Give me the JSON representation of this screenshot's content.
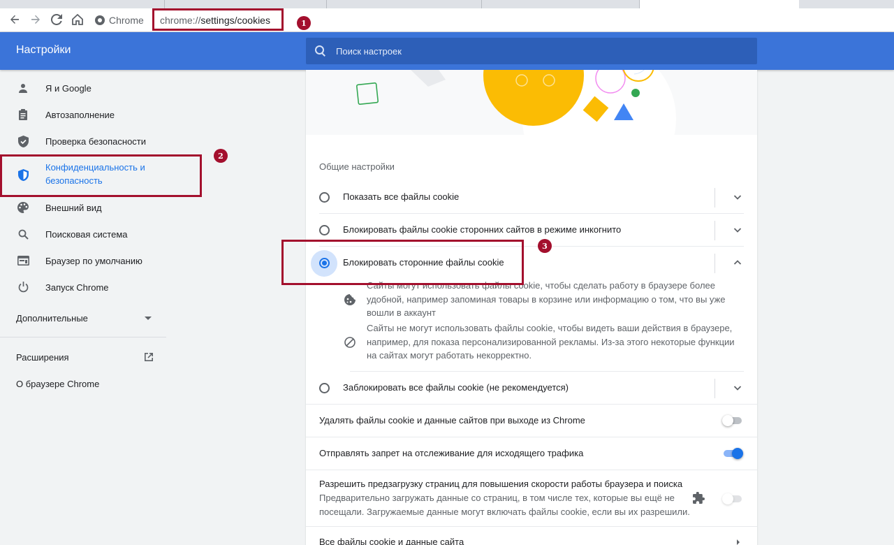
{
  "toolbar": {
    "chip_label": "Chrome",
    "url_prefix": "chrome://",
    "url_path": "settings/cookies"
  },
  "callouts": [
    "1",
    "2",
    "3"
  ],
  "header": {
    "title": "Настройки",
    "search_placeholder": "Поиск настроек"
  },
  "sidebar": {
    "items": [
      {
        "label": "Я и Google",
        "icon": "person-icon"
      },
      {
        "label": "Автозаполнение",
        "icon": "clipboard-icon"
      },
      {
        "label": "Проверка безопасности",
        "icon": "shield-check-icon"
      },
      {
        "label": "Конфиденциальность и безопасность",
        "icon": "shield-icon",
        "active": true
      },
      {
        "label": "Внешний вид",
        "icon": "palette-icon"
      },
      {
        "label": "Поисковая система",
        "icon": "search-icon"
      },
      {
        "label": "Браузер по умолчанию",
        "icon": "browser-icon"
      },
      {
        "label": "Запуск Chrome",
        "icon": "power-icon"
      }
    ],
    "advanced_label": "Дополнительные",
    "extensions_label": "Расширения",
    "about_label": "О браузере Chrome"
  },
  "main": {
    "section_label": "Общие настройки",
    "options": [
      {
        "label": "Показать все файлы cookie",
        "checked": false,
        "expanded": false
      },
      {
        "label": "Блокировать файлы cookie сторонних сайтов в режиме инкогнито",
        "checked": false,
        "expanded": false
      },
      {
        "label": "Блокировать сторонние файлы cookie",
        "checked": true,
        "expanded": true
      },
      {
        "label": "Заблокировать все файлы cookie (не рекомендуется)",
        "checked": false,
        "expanded": false
      }
    ],
    "expanded_details": [
      {
        "icon": "cookie-icon",
        "text": "Сайты могут использовать файлы cookie, чтобы сделать работу в браузере более удобной, например запоминая товары в корзине или информацию о том, что вы уже вошли в аккаунт"
      },
      {
        "icon": "block-icon",
        "text": "Сайты не могут использовать файлы cookie, чтобы видеть ваши действия в браузере, например, для показа персонализированной рекламы. Из-за этого некоторые функции на сайтах могут работать некорректно."
      }
    ],
    "clear_on_exit": {
      "label": "Удалять файлы cookie и данные сайтов при выходе из Chrome",
      "on": false
    },
    "do_not_track": {
      "label": "Отправлять запрет на отслеживание для исходящего трафика",
      "on": true
    },
    "preload": {
      "label": "Разрешить предзагрузку страниц для повышения скорости работы браузера и поиска",
      "sub": "Предварительно загружать данные со страниц, в том числе тех, которые вы ещё не посещали. Загружаемые данные могут включать файлы cookie, если вы их разрешили.",
      "on": false
    },
    "all_cookies_label": "Все файлы cookie и данные сайта"
  },
  "colors": {
    "header_blue": "#3b74d9",
    "accent": "#1a73e8",
    "callout": "#a30f2d"
  }
}
